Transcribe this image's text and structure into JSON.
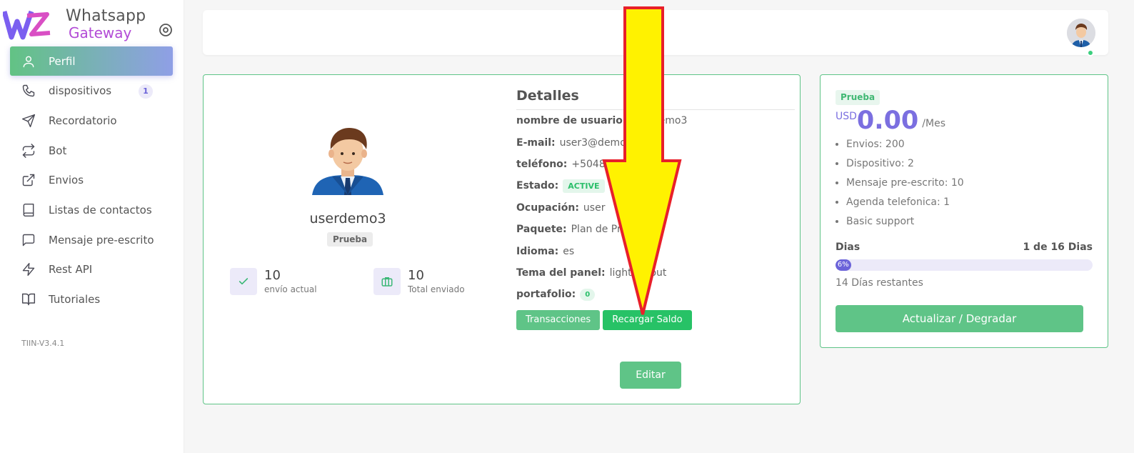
{
  "brand": {
    "line1": "Whatsapp",
    "line2": "Gateway"
  },
  "sidebar": {
    "items": [
      {
        "label": "Perfil"
      },
      {
        "label": "dispositivos",
        "badge": "1"
      },
      {
        "label": "Recordatorio"
      },
      {
        "label": "Bot"
      },
      {
        "label": "Envios"
      },
      {
        "label": "Listas de contactos"
      },
      {
        "label": "Mensaje pre-escrito"
      },
      {
        "label": "Rest API"
      },
      {
        "label": "Tutoriales"
      }
    ],
    "version": "TIIN-V3.4.1"
  },
  "profile": {
    "username": "userdemo3",
    "plan": "Prueba",
    "stats": [
      {
        "value": "10",
        "label": "envío actual"
      },
      {
        "value": "10",
        "label": "Total enviado"
      }
    ],
    "details_title": "Detalles",
    "details": {
      "username": {
        "key": "nombre de usuario:",
        "value": "userdemo3"
      },
      "email": {
        "key": "E-mail:",
        "value": "user3@demo.com"
      },
      "phone": {
        "key": "teléfono:",
        "value": "+50489520312"
      },
      "status": {
        "key": "Estado:",
        "value": "ACTIVE"
      },
      "occupation": {
        "key": "Ocupación:",
        "value": "user"
      },
      "package": {
        "key": "Paquete:",
        "value": "Plan de Prueba"
      },
      "language": {
        "key": "Idioma:",
        "value": "es"
      },
      "theme": {
        "key": "Tema del panel:",
        "value": "light-layout"
      },
      "portfolio": {
        "key": "portafolio:",
        "value": "0"
      }
    },
    "buttons": {
      "transactions": "Transacciones",
      "recharge": "Recargar Saldo",
      "edit": "Editar"
    }
  },
  "plan": {
    "badge": "Prueba",
    "currency": "USD",
    "amount": "0.00",
    "period": "/Mes",
    "features": [
      "Envios: 200",
      "Dispositivo: 2",
      "Mensaje pre-escrito: 10",
      "Agenda telefonica: 1",
      "Basic support"
    ],
    "days_label": "Dias",
    "days_value": "1 de 16 Dias",
    "progress_label": "6%",
    "progress_fraction": 0.06,
    "days_left": "14 Días restantes",
    "upgrade_button": "Actualizar / Degradar"
  },
  "colors": {
    "accent": "#5fc487",
    "primary": "#6b63d9",
    "arrow_fill": "#fff200",
    "arrow_stroke": "#e8202a"
  }
}
